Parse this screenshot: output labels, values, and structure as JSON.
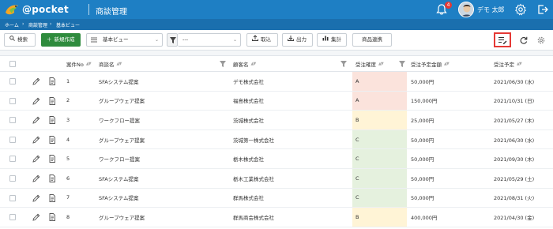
{
  "header": {
    "logo_text": "@pocket",
    "page_title": "商談管理",
    "notification_count": "4",
    "user_name": "デモ 太郎"
  },
  "breadcrumb": [
    "ホーム",
    "商談管理",
    "基本ビュー"
  ],
  "toolbar": {
    "search_label": "検索",
    "new_label": "新規作成",
    "view_selected": "基本ビュー",
    "filter_selected": "---",
    "import_label": "取込",
    "export_label": "出力",
    "aggregate_label": "集計",
    "product_link_label": "商品連携"
  },
  "table": {
    "columns": [
      "案件No",
      "商談名",
      "顧客名",
      "受注確度",
      "受注予定金額",
      "受注予定"
    ],
    "rows": [
      {
        "no": "1",
        "name": "SFAシステム提案",
        "customer": "デモ株式会社",
        "confidence": "A",
        "amount": "50,000円",
        "date": "2021/06/30 (水)"
      },
      {
        "no": "2",
        "name": "グループウェア提案",
        "customer": "福島株式会社",
        "confidence": "A",
        "amount": "150,000円",
        "date": "2021/10/31 (日)"
      },
      {
        "no": "3",
        "name": "ワークフロー提案",
        "customer": "茨城株式会社",
        "confidence": "B",
        "amount": "25,000円",
        "date": "2021/05/27 (木)"
      },
      {
        "no": "4",
        "name": "グループウェア提案",
        "customer": "茨城第一株式会社",
        "confidence": "C",
        "amount": "50,000円",
        "date": "2021/06/30 (水)"
      },
      {
        "no": "5",
        "name": "ワークフロー提案",
        "customer": "栃木株式会社",
        "confidence": "C",
        "amount": "50,000円",
        "date": "2021/09/30 (木)"
      },
      {
        "no": "6",
        "name": "SFAシステム提案",
        "customer": "栃木工業株式会社",
        "confidence": "C",
        "amount": "50,000円",
        "date": "2021/05/29 (土)"
      },
      {
        "no": "7",
        "name": "SFAシステム提案",
        "customer": "群馬株式会社",
        "confidence": "C",
        "amount": "50,000円",
        "date": "2021/08/31 (火)"
      },
      {
        "no": "8",
        "name": "グループウェア提案",
        "customer": "群馬商会株式会社",
        "confidence": "B",
        "amount": "400,000円",
        "date": "2021/04/30 (金)"
      }
    ]
  },
  "colors": {
    "header_bg": "#1e7fc4",
    "primary_green": "#2e8b3d",
    "confidence_A": "#fbe3dc",
    "confidence_B": "#fff4d6",
    "confidence_C": "#e5f1de",
    "highlight_red": "#e53935"
  }
}
